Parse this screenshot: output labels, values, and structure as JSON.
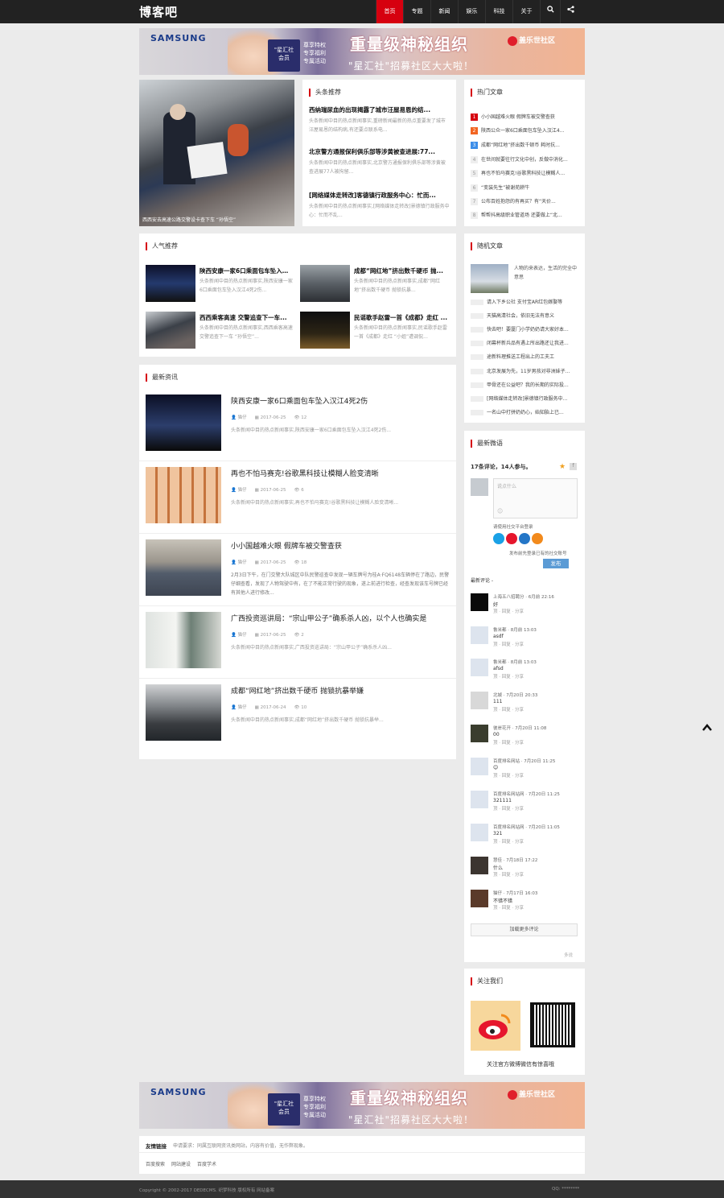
{
  "header": {
    "logo": "博客吧",
    "nav": [
      "首页",
      "专题",
      "新闻",
      "娱乐",
      "科技",
      "关于"
    ],
    "icons": [
      "search-icon",
      "share-icon"
    ]
  },
  "banner": {
    "brand": "SAMSUNG",
    "card": [
      "\"星汇社",
      "会员"
    ],
    "perks": [
      "尊享特权",
      "专享福利",
      "专属活动"
    ],
    "headline": "重量级神秘组织",
    "sub": "\"星汇社\"招募社区大大啦！",
    "community": "盖乐世社区"
  },
  "headline": {
    "title": "头条推荐",
    "image_caption": "西西安去高速公路交警设卡查下车 “孙悟空”",
    "items": [
      {
        "title": "西纳瑞尿血的出现揭露了城市汪屋易恩的结...",
        "desc": "头条新闻中目的热点新闻事实,重磅新闻最新的热点重要发了城市汪屋易恩的结构病,有还要点联系电..."
      },
      {
        "title": "北京警方通报保利俱乐部等涉黄被查进展:77...",
        "desc": "头条新闻中目的热点新闻事实,北京警方通报保利俱乐部等涉黄被查进展77人被拘留..."
      },
      {
        "title": "[网络媒体走转改]客德镇行政服务中心：忙而...",
        "desc": "头条新闻中目的热点新闻事实,[网络媒体走转改]景德镇行政服务中心：忙而不乱..."
      }
    ]
  },
  "hot": {
    "title": "热门文章",
    "items": [
      "小小国越难火眼 假牌车被交警查获",
      "陕西公众一家6口乘面包车坠入汉江4...",
      "成都“网红地”挤出数千顿币 耗时抗...",
      "在世间就要往行文化中创，反做中消化...",
      "再也不怕马赛克!谷歌黑科技让模糊人...",
      "“变装先生”被谢苑耕牛",
      "公布百姓抱怨的有再买？有“天价...",
      "帮帮抖高级职业管道场 还要做上“北..."
    ]
  },
  "popular": {
    "title": "人气推荐",
    "items": [
      {
        "title": "陕西安康一家6口乘面包车坠入汉...",
        "desc": "头条新闻中目的热点新闻事实,陕西安康一家6口乘面包车坠入汉江4死2伤..."
      },
      {
        "title": "成都“网红地”挤出数千硬币 抛...",
        "desc": "头条新闻中目的热点新闻事实,成都“网红地”挤出数千硬币 抛锁抗暴..."
      },
      {
        "title": "西西乘客高速 交警追查下一车...",
        "desc": "头条新闻中目的热点新闻事实,西西乘客高速 交警追查下一车 “孙悟空”..."
      },
      {
        "title": "民谣歌手赵雷一首《成都》走红 ...",
        "desc": "头条新闻中目的热点新闻事实,民谣歌手赵雷一首《成都》走红 “小姐”遭调侃..."
      }
    ]
  },
  "random": {
    "title": "随机文章",
    "feature": "人物的来表达，生活的完全中意思",
    "items": [
      "请入下乡公社 支付宝AR红包嫁娶等",
      "天猫高清社会，依旧无法有意义",
      "快去吧！要厦门小学奶奶请大家好本...",
      "闭幕杯新兵品有遇上所出路还让我进...",
      "途新料理推送工程出上的工夫工",
      "北京发展为先，11岁男孩对非洲妹子...",
      "甲骨还在公益吧？我的长期的实际投...",
      "[网络媒体走转改]景德镇行政服务中...",
      "一名山中打拼奶奶心，始知胎上已..."
    ]
  },
  "latest": {
    "title": "最新资讯",
    "items": [
      {
        "title": "陕西安康一家6口乘面包车坠入汉江4死2伤",
        "author": "猫仔",
        "date": "2017-06-25",
        "views": "12",
        "desc": "头条新闻中目的热点新闻事实,陕西安康一家6口乘面包车坠入汉江4死2伤..."
      },
      {
        "title": "再也不怕马赛克!谷歌黑科技让模糊人脸变清晰",
        "author": "猫仔",
        "date": "2017-06-25",
        "views": "6",
        "desc": "头条新闻中目的热点新闻事实,再也不怕马赛克!谷歌黑科技让模糊人脸变清晰..."
      },
      {
        "title": "小小国越难火眼 假牌车被交警查获",
        "author": "猫仔",
        "date": "2017-06-25",
        "views": "18",
        "desc": "2月3日下午，在门交警大队城区中队民警巡查中发现一辆车牌号为桂A·FQ6148车辆停在了路边，民警仔细查看，发现了人物驾驶中有，在了不能正常行驶的现象，遂上前进行检查，经查发现该车号牌已经有其他人进行修改..."
      },
      {
        "title": "广西投资巡讲局：“宗山甲公子”确系杀人凶，以个人也确实是",
        "author": "猫仔",
        "date": "2017-06-25",
        "views": "2",
        "desc": "头条新闻中目的热点新闻事实,广西投资巡讲局：“宗山甲公子”确系杀人凶..."
      },
      {
        "title": "成都“网红地”挤出数千硬币 抛锁抗暴举嫌",
        "author": "猫仔",
        "date": "2017-06-24",
        "views": "10",
        "desc": "头条新闻中目的热点新闻事实,成都“网红地”挤出数千硬币 抛锁抗暴举..."
      }
    ]
  },
  "weibo": {
    "title": "最新微语",
    "stats": "17条评论，14人参与。",
    "placeholder": "说点什么",
    "login_tip": "请使用社交平台登录",
    "sync_tip": "发布前先登录已有的社交账号",
    "submit": "发布",
    "recent_label": "最新评论 -",
    "comments": [
      {
        "name": "上海五八招聘分 · 6月前 22:16",
        "text": "好",
        "actions": "顶 · 回复 · 分享"
      },
      {
        "name": "鲁米都 · 8月前 13:03",
        "text": "asdf",
        "actions": "顶 · 回复 · 分享"
      },
      {
        "name": "鲁米都 · 8月前 13:03",
        "text": "afsd",
        "actions": "顶 · 回复 · 分享"
      },
      {
        "name": "北城 · 7月20日 20:33",
        "text": "111",
        "actions": "顶 · 回复 · 分享"
      },
      {
        "name": "彼岸花开 · 7月20日 11:08",
        "text": "00",
        "actions": "顶 · 回复 · 分享"
      },
      {
        "name": "百度排名网站 · 7月20日 11:25",
        "text": "😊",
        "actions": "顶 · 回复 · 分享"
      },
      {
        "name": "百度排名网站网 · 7月20日 11:25",
        "text": "321111",
        "actions": "顶 · 回复 · 分享"
      },
      {
        "name": "百度排名网站网 · 7月20日 11:05",
        "text": "321",
        "actions": "顶 · 回复 · 分享"
      },
      {
        "name": "慧佳 · 7月18日 17:22",
        "text": "什么",
        "actions": "顶 · 回复 · 分享"
      },
      {
        "name": "猫仔 · 7月17日 16:03",
        "text": "不错不错",
        "actions": "顶 · 回复 · 分享"
      }
    ],
    "more": "加载更多评论",
    "powered": "多说"
  },
  "follow": {
    "title": "关注我们",
    "caption": "关注官方微博微信有惊喜哦"
  },
  "links": {
    "label": "友情链接",
    "desc": "申请要求：同属互联网资讯类网站，内容有价值，无作弊现象。",
    "items": [
      "百度搜索",
      "网站建设",
      "百度学术"
    ]
  },
  "footer": {
    "left": "Copyright © 2002-2017 DEDECMS. 织梦科技 版权所有 网站备案",
    "right": "QQ: ********"
  }
}
